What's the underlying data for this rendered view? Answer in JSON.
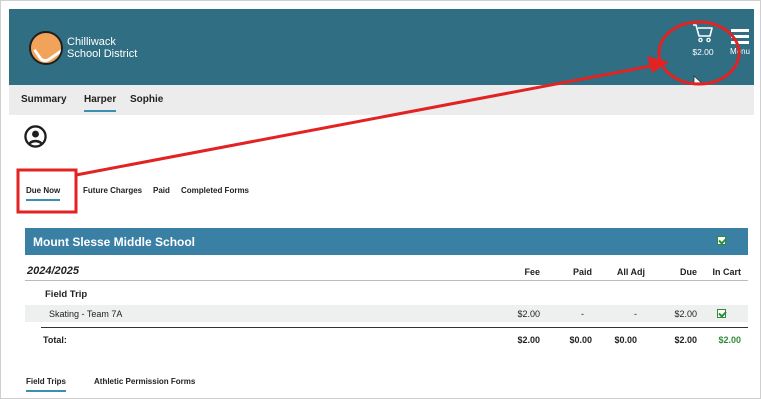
{
  "header": {
    "district_line1": "Chilliwack",
    "district_line2": "School District",
    "cart_total": "$2.00",
    "menu_label": "Menu",
    "cart_icon": "cart-icon",
    "menu_icon": "hamburger-icon"
  },
  "student_tabs": [
    "Summary",
    "Harper",
    "Sophie"
  ],
  "active_student_tab": "Harper",
  "sub_tabs": [
    "Due Now",
    "Future Charges",
    "Paid",
    "Completed Forms"
  ],
  "active_sub_tab": "Due Now",
  "school": {
    "name": "Mount Slesse Middle School",
    "header_checked": true
  },
  "table": {
    "year": "2024/2025",
    "columns": [
      "Fee",
      "Paid",
      "All Adj",
      "Due",
      "In Cart"
    ],
    "category": "Field Trip",
    "items": [
      {
        "name": "Skating - Team 7A",
        "fee": "$2.00",
        "paid": "-",
        "adj": "-",
        "due": "$2.00",
        "in_cart": true
      }
    ],
    "total": {
      "label": "Total:",
      "fee": "$2.00",
      "paid": "$0.00",
      "adj": "$0.00",
      "due": "$2.00",
      "in_cart": "$2.00"
    }
  },
  "bottom_tabs": [
    "Field Trips",
    "Athletic Permission Forms"
  ],
  "active_bottom_tab": "Field Trips",
  "colors": {
    "header_bg": "#2f6e83",
    "school_bar": "#3a7fa4",
    "annotation_red": "#e32222",
    "accent_green": "#2e8b3a"
  }
}
